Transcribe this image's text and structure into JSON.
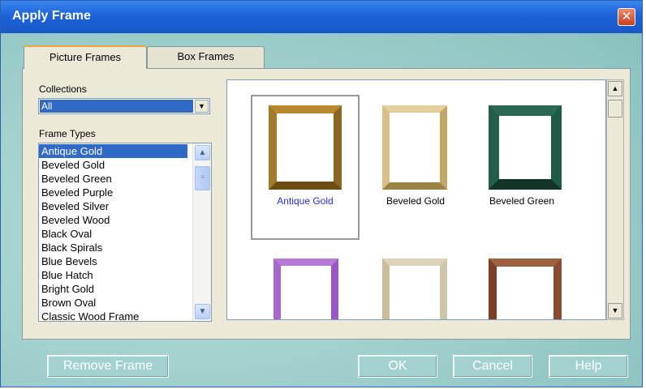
{
  "window": {
    "title": "Apply Frame",
    "close_glyph": "✕"
  },
  "tabs": [
    {
      "label": "Picture Frames",
      "active": true
    },
    {
      "label": "Box Frames",
      "active": false
    }
  ],
  "collections": {
    "label": "Collections",
    "value": "All"
  },
  "frame_types": {
    "label": "Frame Types",
    "items": [
      "Antique Gold",
      "Beveled Gold",
      "Beveled Green",
      "Beveled Purple",
      "Beveled Silver",
      "Beveled Wood",
      "Black Oval",
      "Black Spirals",
      "Blue Bevels",
      "Blue Hatch",
      "Bright Gold",
      "Brown Oval",
      "Classic Wood Frame"
    ],
    "selected": "Antique Gold"
  },
  "gallery": {
    "tiles": [
      {
        "label": "Antique Gold",
        "color": "#b8892e",
        "accent": "#6b4d12",
        "selected": true,
        "label_color": "#2b2bd1"
      },
      {
        "label": "Beveled Gold",
        "color": "#d7c089",
        "accent": "#9b8344",
        "selected": false,
        "label_color": "#000000"
      },
      {
        "label": "Beveled Green",
        "color": "#1f5a46",
        "accent": "#123528",
        "selected": false,
        "label_color": "#000000"
      },
      {
        "label": "",
        "color": "#9a57c4",
        "accent": "#6f2e99",
        "selected": false
      },
      {
        "label": "",
        "color": "#cfc5a8",
        "accent": "#8e8268",
        "selected": false
      },
      {
        "label": "",
        "color": "#8a4b33",
        "accent": "#5a2d1c",
        "selected": false
      }
    ]
  },
  "buttons": {
    "remove_frame": "Remove Frame",
    "ok": "OK",
    "cancel": "Cancel",
    "help": "Help"
  }
}
